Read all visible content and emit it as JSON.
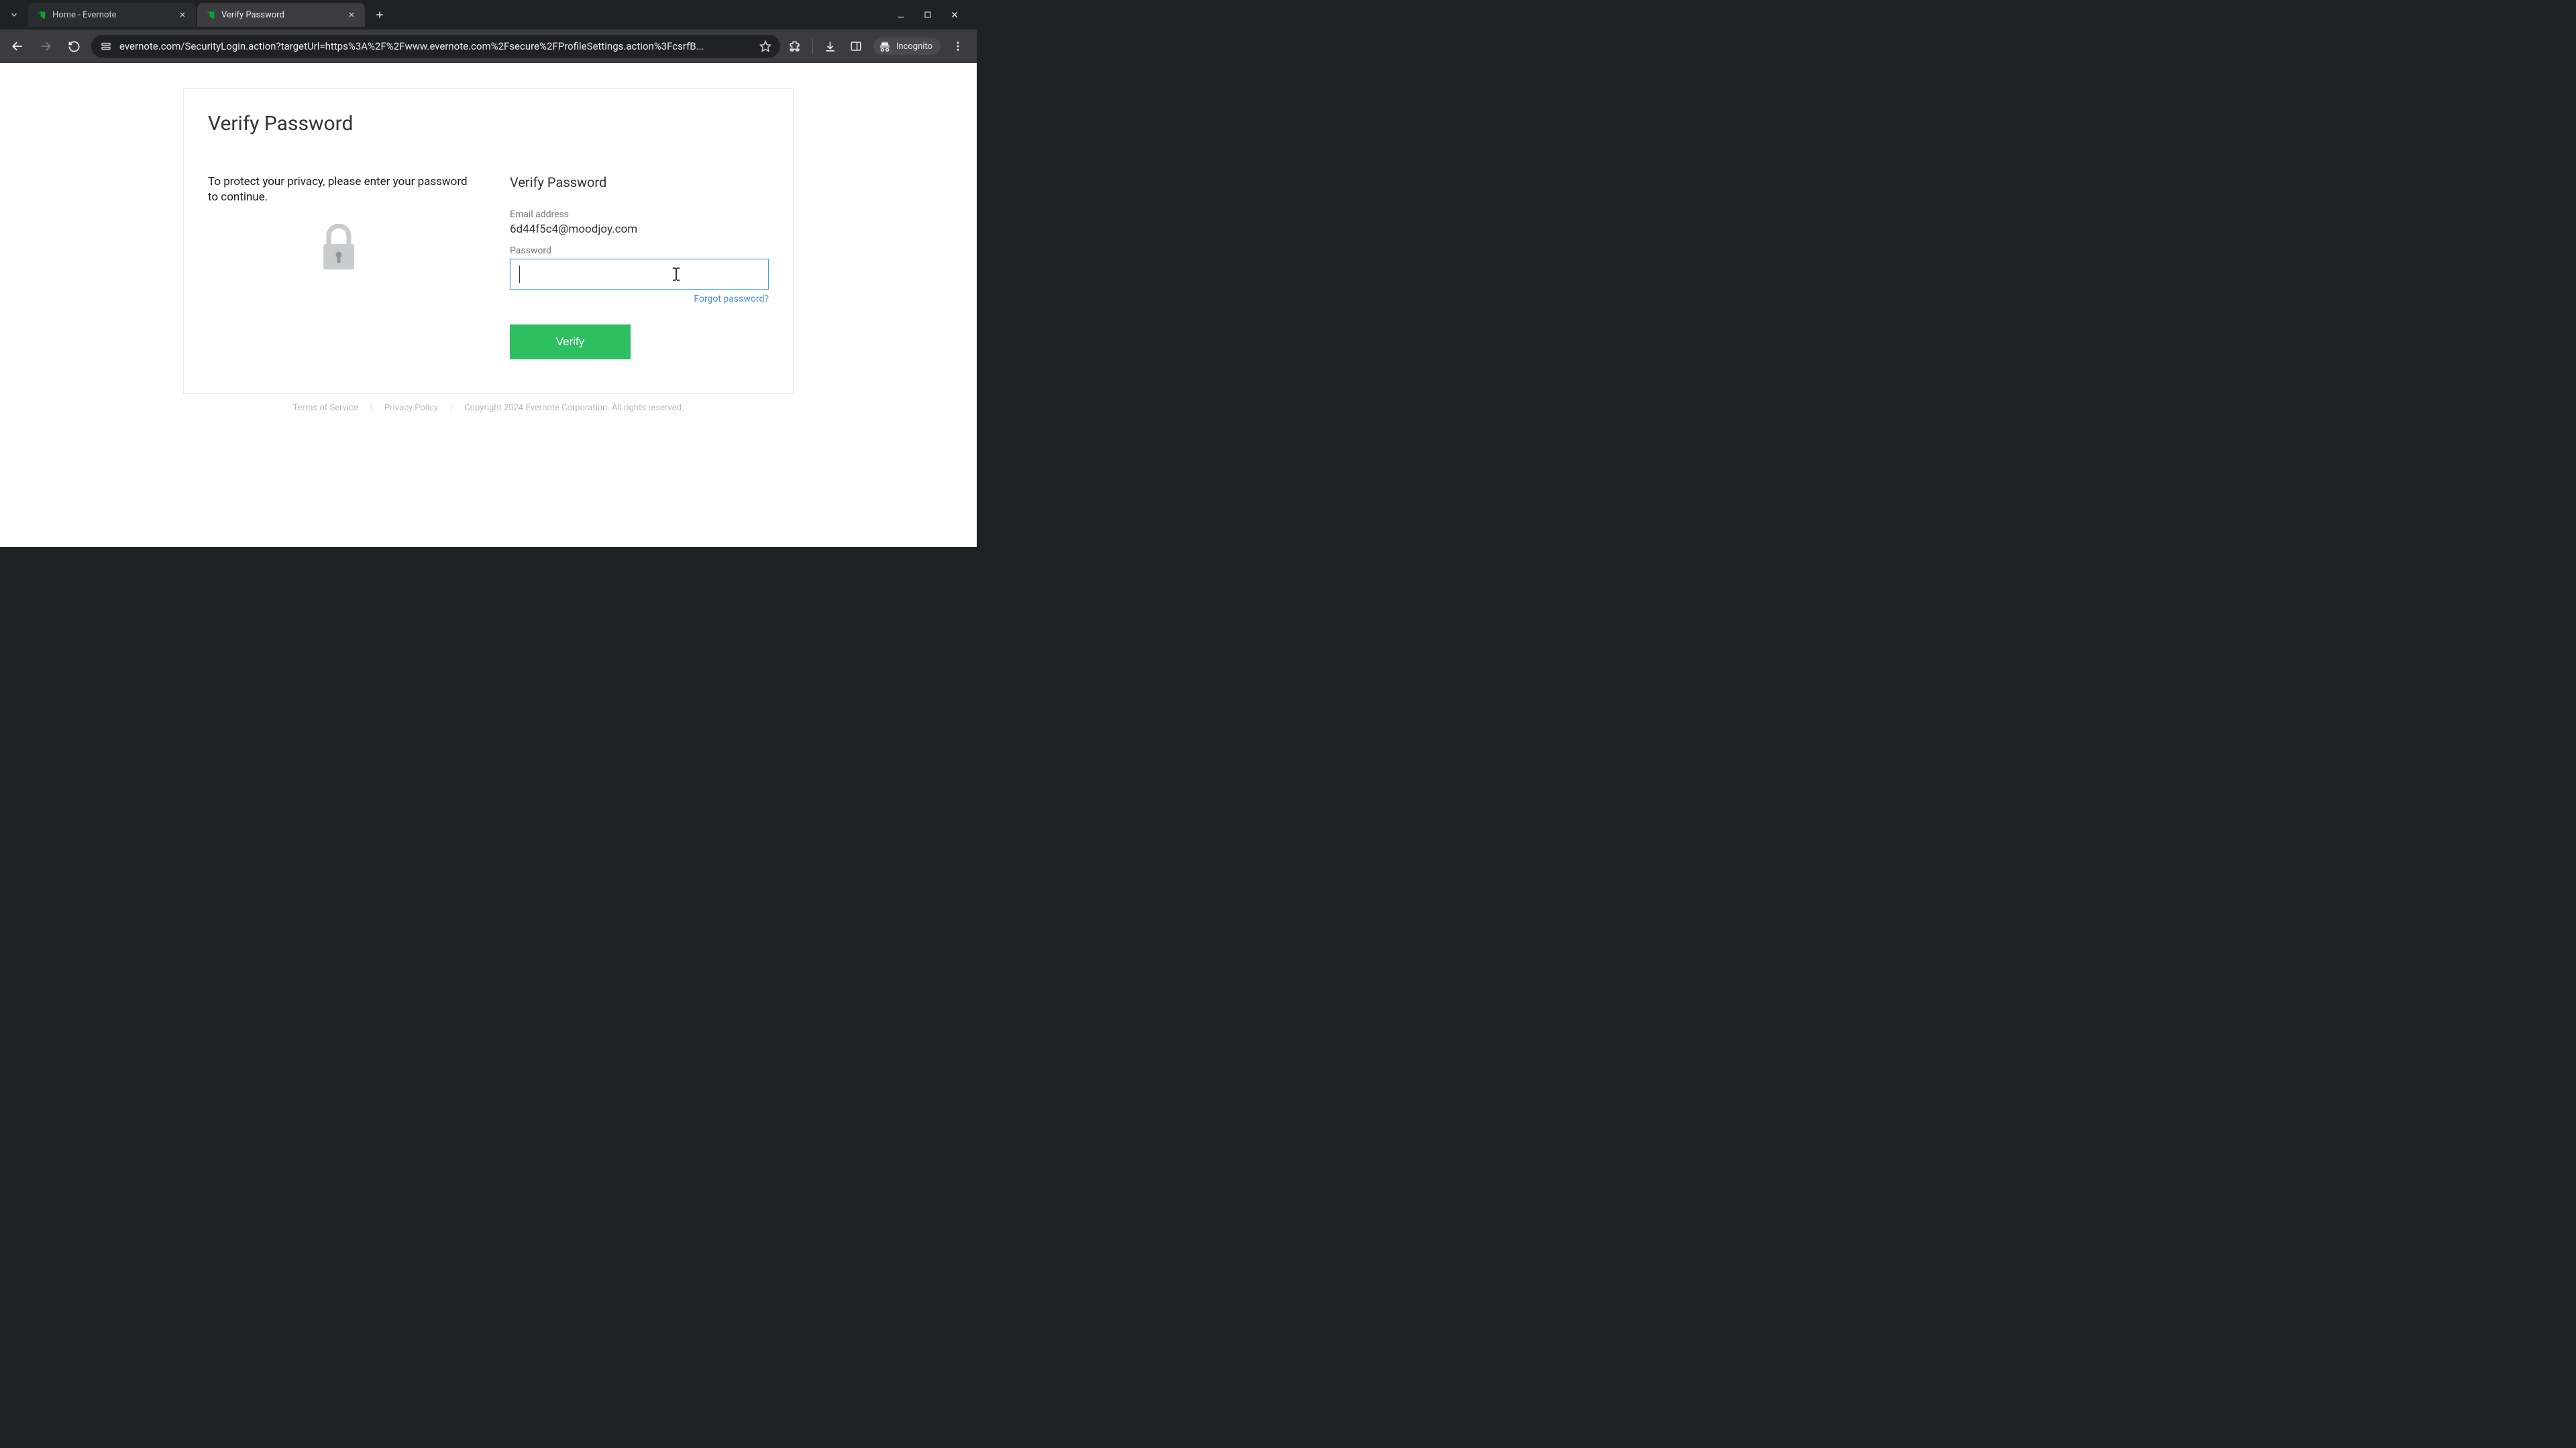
{
  "browser": {
    "tabs": [
      {
        "title": "Home - Evernote",
        "active": false
      },
      {
        "title": "Verify Password",
        "active": true
      }
    ],
    "url": "evernote.com/SecurityLogin.action?targetUrl=https%3A%2F%2Fwww.evernote.com%2Fsecure%2FProfileSettings.action%3FcsrfB...",
    "incognito_label": "Incognito"
  },
  "page": {
    "heading": "Verify Password",
    "intro": "To protect your privacy, please enter your password to continue.",
    "form": {
      "title": "Verify Password",
      "email_label": "Email address",
      "email_value": "6d44f5c4@moodjoy.com",
      "password_label": "Password",
      "password_value": "",
      "forgot_link": "Forgot password?",
      "submit_label": "Verify"
    }
  },
  "footer": {
    "terms": "Terms of Service",
    "privacy": "Privacy Policy",
    "copyright": "Copyright 2024 Evernote Corporation. All rights reserved."
  }
}
